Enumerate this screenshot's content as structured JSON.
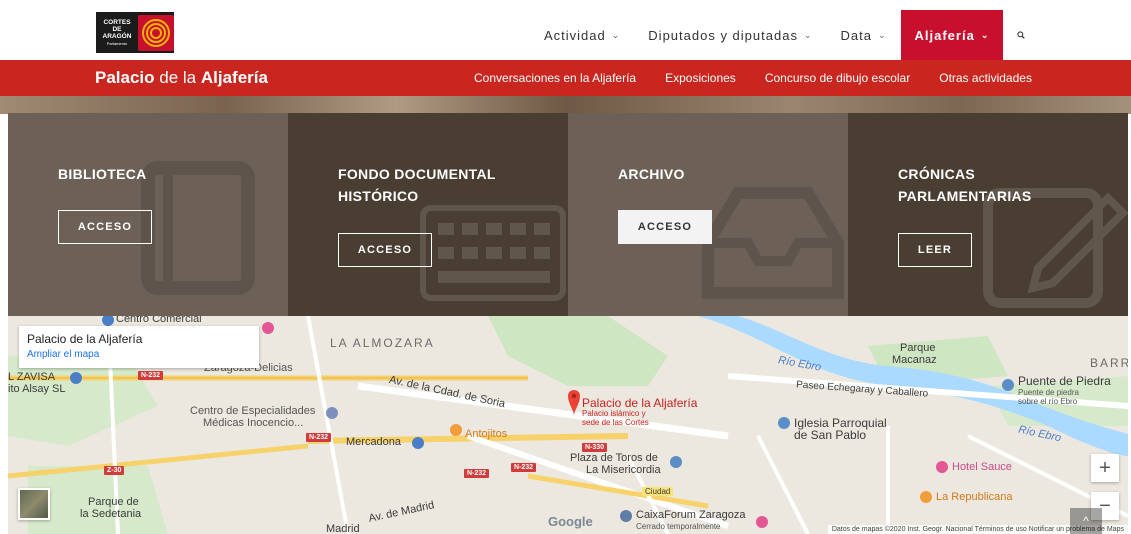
{
  "logo": {
    "line1": "CORTES",
    "line2": "DE",
    "line3": "ARAGÓN",
    "line4": "Parlamento"
  },
  "nav": {
    "items": [
      {
        "label": "Actividad"
      },
      {
        "label": "Diputados y diputadas"
      },
      {
        "label": "Data"
      },
      {
        "label": "Aljafería"
      }
    ],
    "search_icon": "search-icon",
    "active_color": "#c8102e"
  },
  "subbar": {
    "title_a": "Palacio",
    "title_b": " de la ",
    "title_c": "Aljafería",
    "links": [
      "Conversaciones en la Aljafería",
      "Exposiciones",
      "Concurso de dibujo escolar",
      "Otras actividades"
    ],
    "color": "#c8261e"
  },
  "panels": [
    {
      "title_line1": "BIBLIOTECA",
      "title_line2": "",
      "button": "ACCESO",
      "icon": "book-icon"
    },
    {
      "title_line1": "FONDO DOCUMENTAL",
      "title_line2": "HISTÓRICO",
      "button": "ACCESO",
      "icon": "keyboard-icon"
    },
    {
      "title_line1": "ARCHIVO",
      "title_line2": "",
      "button": "ACCESO",
      "icon": "tray-icon"
    },
    {
      "title_line1": "CRÓNICAS",
      "title_line2": "PARLAMENTARIAS",
      "button": "LEER",
      "icon": "edit-icon"
    }
  ],
  "map": {
    "card_title": "Palacio de la Aljafería",
    "card_link": "Ampliar el mapa",
    "marker_title": "Palacio de la Aljafería",
    "marker_sub1": "Palacio islámico y",
    "marker_sub2": "sede de las Cortes",
    "labels": {
      "almozara": "LA ALMOZARA",
      "centro_comercial": "Centro Comercial",
      "zaragoza_delicias": "Zaragoza-Delicias",
      "zavisa": "L ZAVISA",
      "alsay": "ito Alsay SL",
      "centro_esp_1": "Centro de Especialidades",
      "centro_esp_2": "Médicas Inocencio...",
      "mercadona": "Mercadona",
      "antojitos": "Antojitos",
      "plaza_toros_1": "Plaza de Toros de",
      "plaza_toros_2": "La Misericordia",
      "parque_sedetania_1": "Parque de",
      "parque_sedetania_2": "la Sedetania",
      "caixaforum_1": "CaixaForum Zaragoza",
      "caixaforum_2": "Cerrado temporalmente",
      "rio_ebro_1": "Río Ebro",
      "rio_ebro_2": "Río Ebro",
      "parque_macanaz_1": "Parque",
      "parque_macanaz_2": "Macanaz",
      "barr": "BARR",
      "puente_piedra_1": "Puente de Piedra",
      "puente_piedra_2": "Puente de piedra",
      "puente_piedra_3": "sobre el río Ebro",
      "paseo_echegaray": "Paseo Echegaray y Caballero",
      "iglesia_1": "Iglesia Parroquial",
      "iglesia_2": "de San Pablo",
      "hotel_sauce": "Hotel Sauce",
      "la_republicana": "La Republicana",
      "av_ciudad_soria": "Av. de la Cdad. de Soria",
      "av_madrid": "Av. de Madrid",
      "madrid": "Madrid",
      "ciudad": "Ciudad",
      "google": "Google",
      "n232_a": "N-232",
      "n232_b": "N-232",
      "n232_c": "N-232",
      "n232_d": "N-232",
      "n330": "N-330",
      "z30": "Z-30"
    },
    "attribution": "Datos de mapas ©2020 Inst. Geogr. Nacional   Términos de uso   Notificar un problema de Maps",
    "zoom_in": "+",
    "zoom_out": "−"
  },
  "scroll_top": "^"
}
